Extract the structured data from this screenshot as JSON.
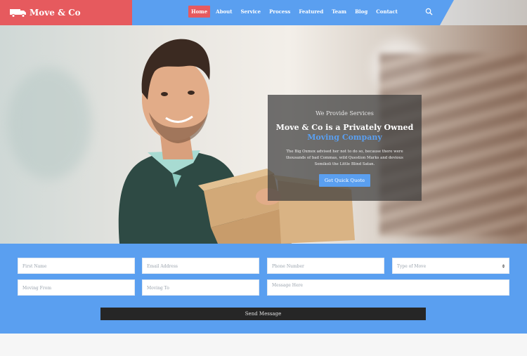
{
  "brand": {
    "name": "Move & Co",
    "color": "#e65a5e"
  },
  "nav": {
    "items": [
      "Home",
      "About",
      "Service",
      "Process",
      "Featured",
      "Team",
      "Blog",
      "Contact"
    ],
    "active": "Home",
    "search_icon": "search-icon",
    "color": "#5a9ff0"
  },
  "hero": {
    "eyebrow": "We Provide Services",
    "title": "Move & Co is a Privately Owned",
    "highlight": "Moving Company",
    "description": "The Big Oxmox advised her not to do so, because there were thousands of bad Commas, wild Question Marks and devious Semikoli the Little Blind Satan.",
    "cta": "Get Quick Quote"
  },
  "form": {
    "first_name": "First Name",
    "email": "Email Address",
    "phone": "Phone Number",
    "type_of_move": "Type of Move",
    "moving_from": "Moving From",
    "moving_to": "Moving To",
    "message": "Message Here",
    "submit": "Send Message"
  }
}
